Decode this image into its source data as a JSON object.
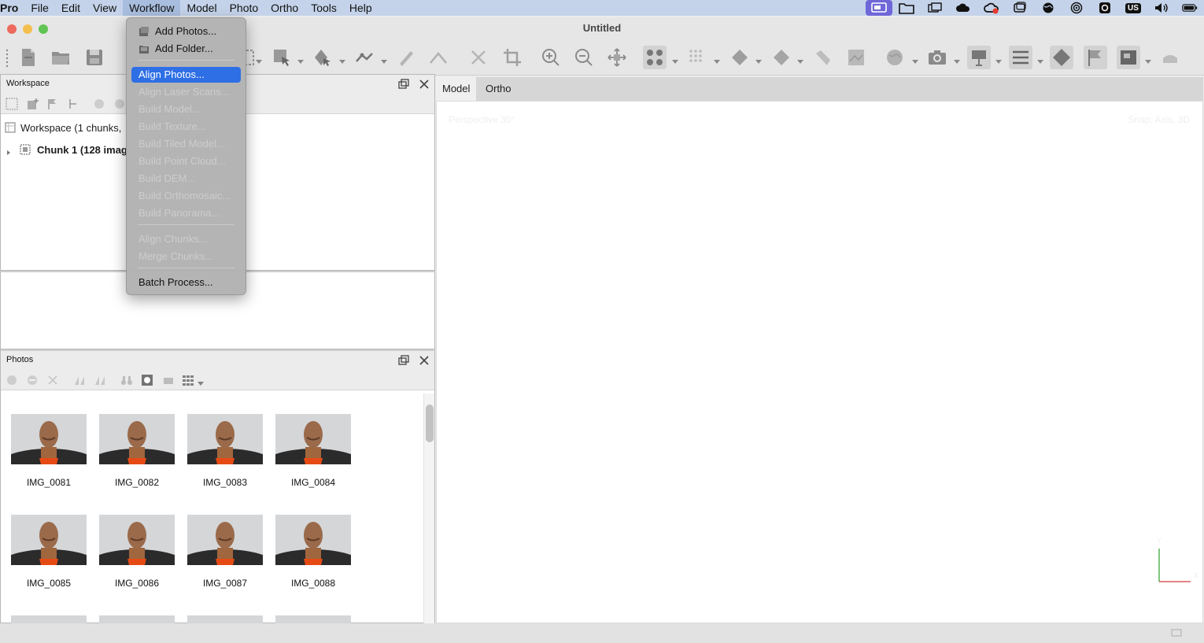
{
  "menubar": {
    "app": "Pro",
    "items": [
      "File",
      "Edit",
      "View",
      "Workflow",
      "Model",
      "Photo",
      "Ortho",
      "Tools",
      "Help"
    ],
    "active": "Workflow",
    "keyboard": "US"
  },
  "window": {
    "title": "Untitled"
  },
  "workspace": {
    "title": "Workspace",
    "root": "Workspace (1 chunks,",
    "chunk": "Chunk 1 (128 imag"
  },
  "photos": {
    "title": "Photos",
    "items": [
      "IMG_0081",
      "IMG_0082",
      "IMG_0083",
      "IMG_0084",
      "IMG_0085",
      "IMG_0086",
      "IMG_0087",
      "IMG_0088"
    ]
  },
  "view_tabs": [
    "Model",
    "Ortho"
  ],
  "viewport": {
    "perspective": "Perspective 30°",
    "snap": "Snap: Axis, 3D",
    "axis_y": "Y",
    "axis_x": "X"
  },
  "workflow_menu": {
    "items": [
      {
        "label": "Add Photos...",
        "enabled": true,
        "icon": "add-photos-icon"
      },
      {
        "label": "Add Folder...",
        "enabled": true,
        "icon": "add-folder-icon"
      },
      {
        "label": "Align Photos...",
        "enabled": true,
        "highlighted": true
      },
      {
        "label": "Align Laser Scans...",
        "enabled": false
      },
      {
        "label": "Build Model...",
        "enabled": false
      },
      {
        "label": "Build Texture...",
        "enabled": false
      },
      {
        "label": "Build Tiled Model...",
        "enabled": false
      },
      {
        "label": "Build Point Cloud...",
        "enabled": false
      },
      {
        "label": "Build DEM...",
        "enabled": false
      },
      {
        "label": "Build Orthomosaic...",
        "enabled": false
      },
      {
        "label": "Build Panorama...",
        "enabled": false
      },
      {
        "label": "Align Chunks...",
        "enabled": false
      },
      {
        "label": "Merge Chunks...",
        "enabled": false
      },
      {
        "label": "Batch Process...",
        "enabled": true
      }
    ]
  },
  "colors": {
    "menubar": "#c4d3ea",
    "highlight": "#2e6fe6",
    "close": "#ed6a5e",
    "minimize": "#f5bf4f",
    "zoom": "#61c554"
  }
}
